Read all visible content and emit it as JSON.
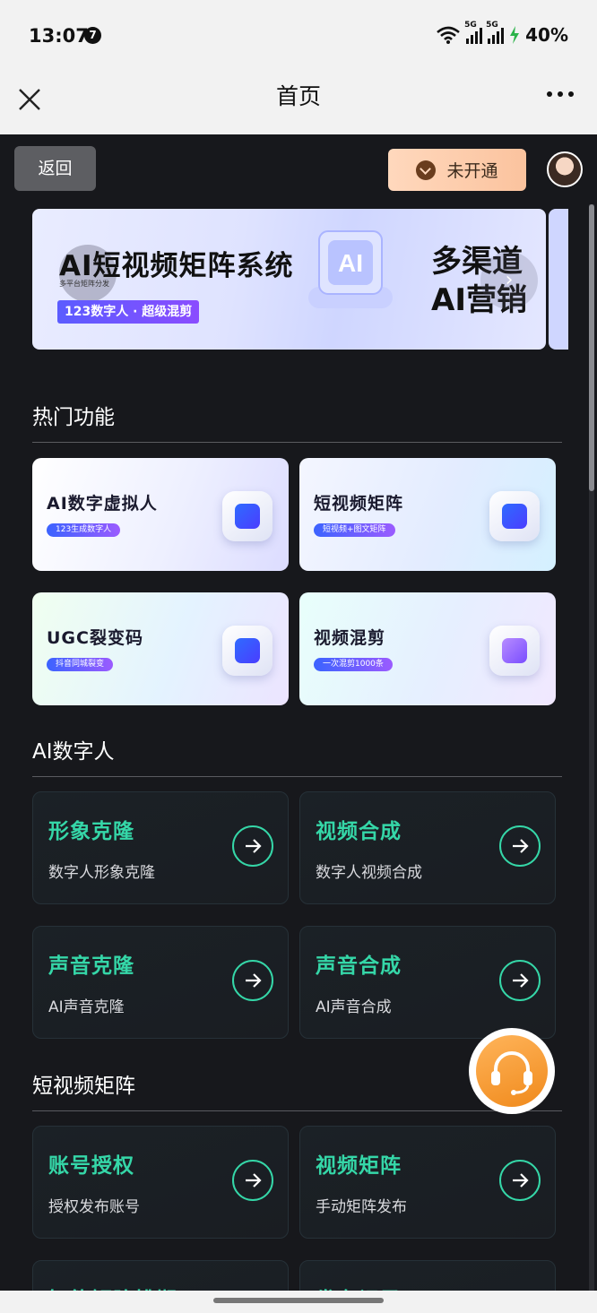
{
  "status_bar": {
    "time": "13:07",
    "notification_badge": "7",
    "net1": "5G",
    "net2": "5G",
    "battery": "40%"
  },
  "nav": {
    "title": "首页"
  },
  "header": {
    "back_label": "返回",
    "vip_label": "未开通"
  },
  "banner": {
    "title": "AI短视频矩阵系统",
    "small_text": "多平台矩阵分发",
    "tag": "123数字人 · 超级混剪",
    "right_line1": "多渠道",
    "right_line2": "AI营销",
    "ai_text": "AI"
  },
  "sections": {
    "hot": "热门功能",
    "digital": "AI数字人",
    "video": "短视频矩阵"
  },
  "hot_cards": [
    {
      "title": "AI数字虚拟人",
      "tag": "123生成数字人",
      "icon": "digital-human-icon"
    },
    {
      "title": "短视频矩阵",
      "tag": "短视频+图文矩阵",
      "icon": "video-matrix-icon"
    },
    {
      "title": "UGC裂变码",
      "tag": "抖音同城裂变",
      "icon": "ugc-code-icon"
    },
    {
      "title": "视频混剪",
      "tag": "一次混剪1000条",
      "icon": "video-edit-icon"
    }
  ],
  "digital_cards": [
    {
      "title": "形象克隆",
      "sub": "数字人形象克隆"
    },
    {
      "title": "视频合成",
      "sub": "数字人视频合成"
    },
    {
      "title": "声音克隆",
      "sub": "AI声音克隆"
    },
    {
      "title": "声音合成",
      "sub": "AI声音合成"
    }
  ],
  "video_cards": [
    {
      "title": "账号授权",
      "sub": "授权发布账号"
    },
    {
      "title": "视频矩阵",
      "sub": "手动矩阵发布"
    },
    {
      "title": "智能矩阵排期",
      "sub": ""
    },
    {
      "title": "发布记录",
      "sub": ""
    }
  ],
  "colors": {
    "accent": "#35d7a8",
    "background": "#17181c",
    "vip": "#fbc39e",
    "service": "#f08a1c"
  }
}
